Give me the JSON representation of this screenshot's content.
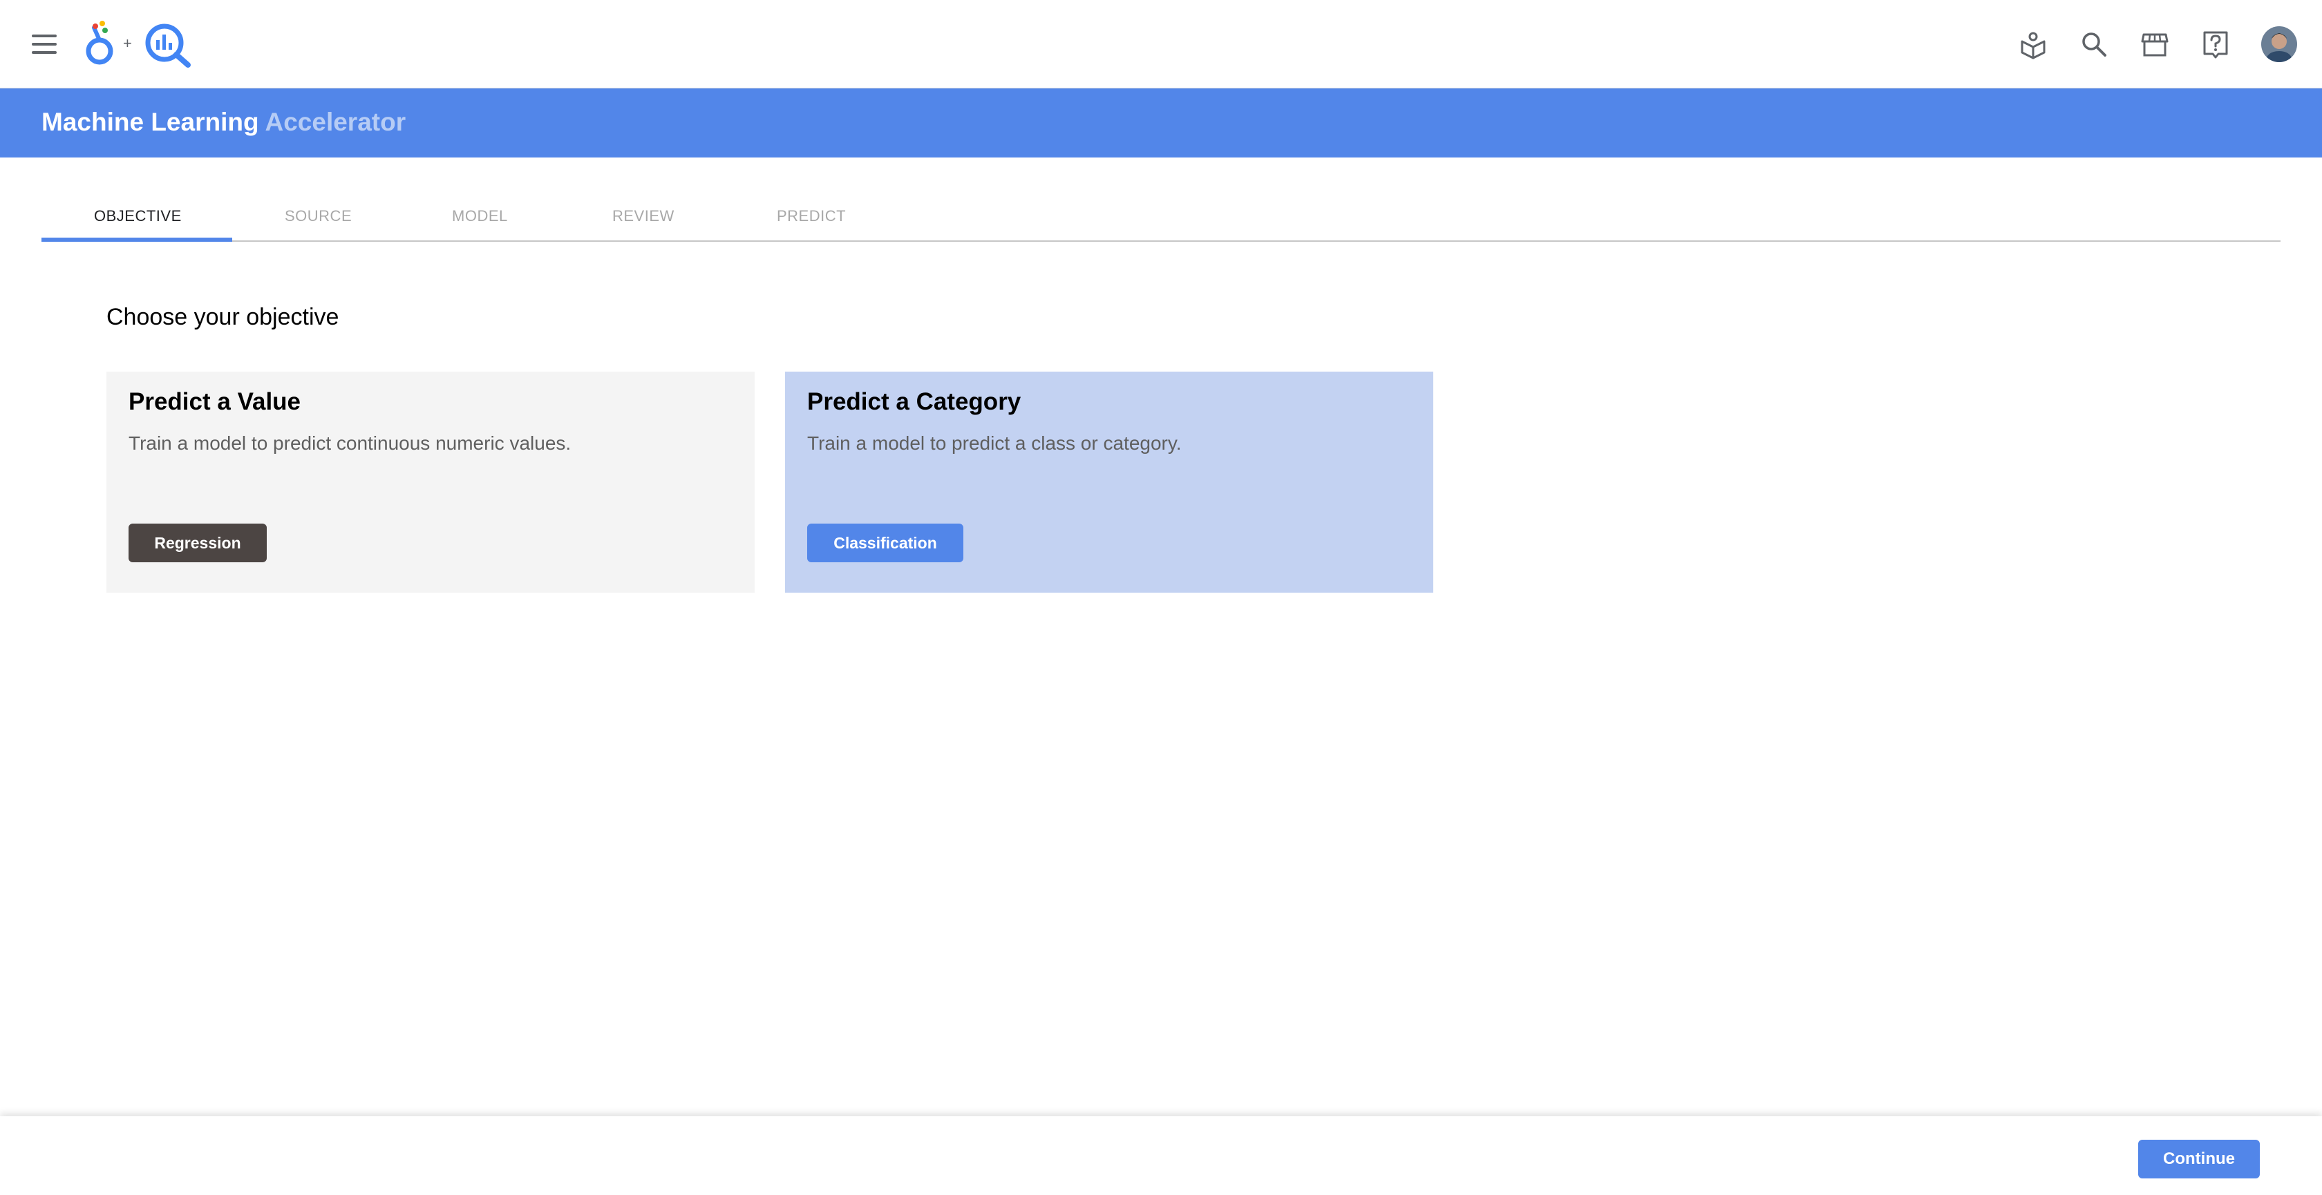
{
  "header": {
    "logo_plus": "+",
    "icons": [
      "learn-icon",
      "search-icon",
      "marketplace-icon",
      "help-icon",
      "account-avatar"
    ]
  },
  "banner": {
    "title_primary": "Machine Learning",
    "title_secondary": "Accelerator"
  },
  "tabs": [
    {
      "label": "OBJECTIVE",
      "active": true
    },
    {
      "label": "SOURCE",
      "active": false
    },
    {
      "label": "MODEL",
      "active": false
    },
    {
      "label": "REVIEW",
      "active": false
    },
    {
      "label": "PREDICT",
      "active": false
    }
  ],
  "main": {
    "heading": "Choose your objective",
    "cards": [
      {
        "title": "Predict a Value",
        "description": "Train a model to predict continuous numeric values.",
        "button": "Regression",
        "selected": false
      },
      {
        "title": "Predict a Category",
        "description": "Train a model to predict a class or category.",
        "button": "Classification",
        "selected": true
      }
    ]
  },
  "footer": {
    "continue_label": "Continue"
  },
  "colors": {
    "accent": "#5286e9",
    "selected_card": "#c3d2f2",
    "card": "#f4f4f4",
    "dark_button": "#4c4543"
  }
}
